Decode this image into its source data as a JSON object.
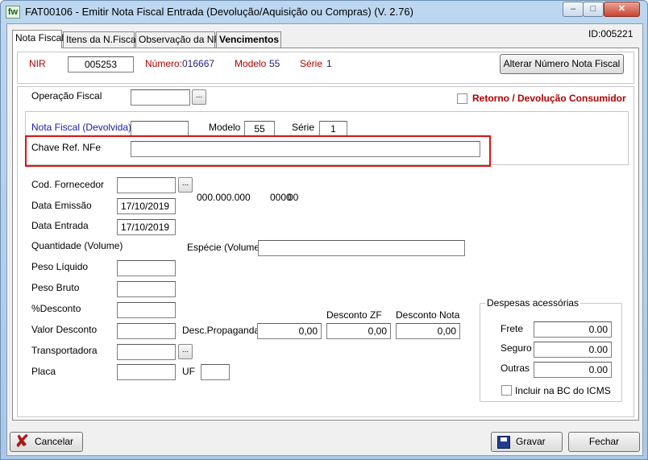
{
  "window": {
    "icon_text": "fw",
    "title": "FAT00106 - Emitir Nota Fiscal Entrada (Devolução/Aquisição ou Compras) (V. 2.76)",
    "minimize": "–",
    "maximize": "□",
    "close": "✕"
  },
  "tabs": [
    {
      "label": "Nota Fiscal"
    },
    {
      "label": "Itens da N.Fiscal"
    },
    {
      "label": "Observação da NF"
    },
    {
      "label": "Vencimentos"
    }
  ],
  "record_id": "ID:005221",
  "header": {
    "nir_label": "NIR",
    "nir_value": "005253",
    "numero_label": "Número:",
    "numero_value": "016667",
    "modelo_label": "Modelo",
    "modelo_value": "55",
    "serie_label": "Série",
    "serie_value": "1",
    "alterar_button": "Alterar Número Nota Fiscal"
  },
  "operacao": {
    "label": "Operação Fiscal",
    "value": "",
    "ellipsis": "...",
    "retorno_label": "Retorno / Devolução Consumidor",
    "retorno_checked": false
  },
  "devolvida": {
    "nf_label": "Nota Fiscal (Devolvida)",
    "nf_value": "",
    "modelo_label": "Modelo",
    "modelo_value": "55",
    "serie_label": "Série",
    "serie_value": "1",
    "chave_label": "Chave Ref. NFe",
    "chave_value": ""
  },
  "form": {
    "cod_fornecedor_label": "Cod. Fornecedor",
    "cod_fornecedor_value": "",
    "fornecedor_doc": "000.000.000",
    "fornecedor_part2": "0000",
    "fornecedor_part3": "00",
    "data_emissao_label": "Data Emissão",
    "data_emissao_value": "17/10/2019",
    "data_entrada_label": "Data Entrada",
    "data_entrada_value": "17/10/2019",
    "quantidade_label": "Quantidade (Volume)",
    "especie_label": "Espécie (Volume)",
    "especie_value": "",
    "peso_liquido_label": "Peso Líquido",
    "peso_liquido_value": "",
    "peso_bruto_label": "Peso Bruto",
    "peso_bruto_value": "",
    "desconto_pct_label": "%Desconto",
    "desconto_pct_value": "",
    "valor_desconto_label": "Valor Desconto",
    "valor_desconto_value": "",
    "desc_propaganda_label": "Desc.Propaganda",
    "desc_propaganda_value": "0,00",
    "desconto_zf_label": "Desconto ZF",
    "desconto_zf_value": "0,00",
    "desconto_nota_label": "Desconto Nota",
    "desconto_nota_value": "0,00",
    "transportadora_label": "Transportadora",
    "transportadora_value": "",
    "placa_label": "Placa",
    "placa_value": "",
    "uf_label": "UF",
    "uf_value": ""
  },
  "despesas": {
    "legend": "Despesas acessórias",
    "frete_label": "Frete",
    "frete_value": "0.00",
    "seguro_label": "Seguro",
    "seguro_value": "0.00",
    "outras_label": "Outras",
    "outras_value": "0.00",
    "incluir_label": "Incluir na BC do ICMS",
    "incluir_checked": false
  },
  "footer": {
    "cancelar": "Cancelar",
    "gravar": "Gravar",
    "fechar": "Fechar"
  },
  "colors": {
    "highlight": "#e01010",
    "red_label": "#b00000",
    "blue_label": "#1a1aa8"
  }
}
